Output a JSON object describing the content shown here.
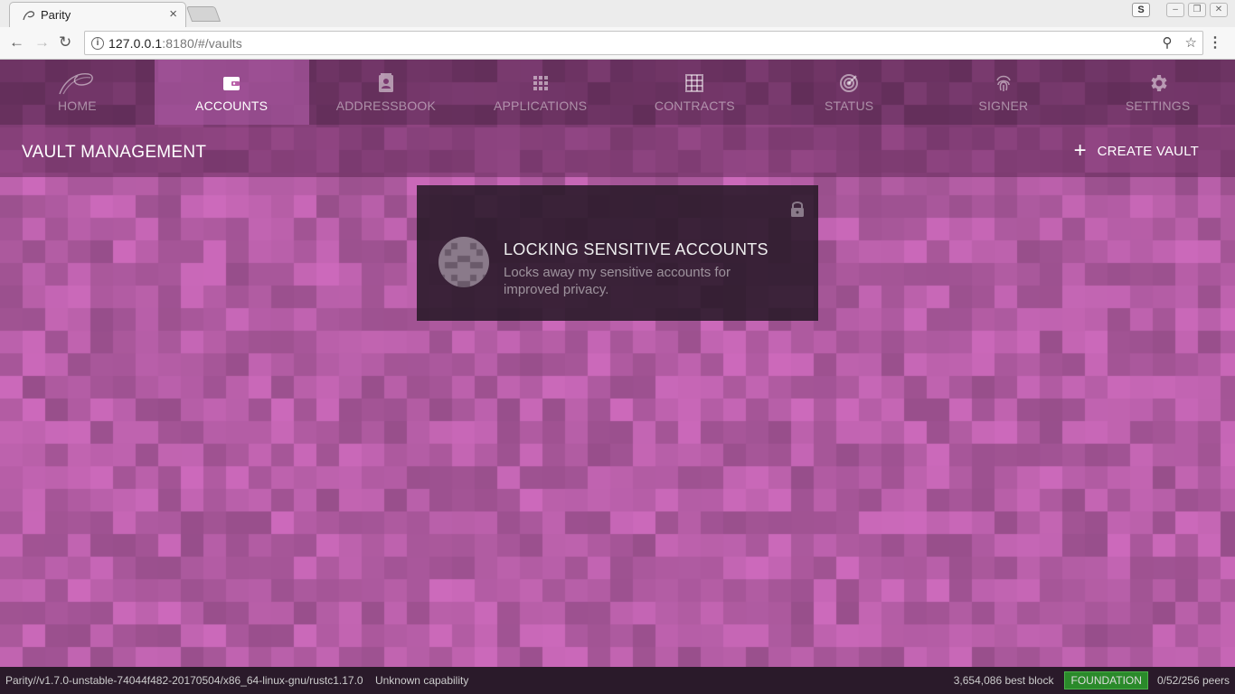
{
  "browser": {
    "tab_title": "Parity",
    "tab_close": "×",
    "profile_letter": "S",
    "url_host": "127.0.0.1",
    "url_rest": ":8180/#/vaults"
  },
  "nav": {
    "items": [
      {
        "label": "HOME",
        "icon": "parity-logo-icon"
      },
      {
        "label": "ACCOUNTS",
        "icon": "wallet-icon",
        "active": true
      },
      {
        "label": "ADDRESSBOOK",
        "icon": "contact-icon"
      },
      {
        "label": "APPLICATIONS",
        "icon": "apps-grid-icon"
      },
      {
        "label": "CONTRACTS",
        "icon": "table-grid-icon"
      },
      {
        "label": "STATUS",
        "icon": "radar-icon"
      },
      {
        "label": "SIGNER",
        "icon": "fingerprint-icon"
      },
      {
        "label": "SETTINGS",
        "icon": "gear-icon"
      }
    ]
  },
  "subheader": {
    "title": "VAULT MANAGEMENT",
    "create_label": "CREATE VAULT"
  },
  "vault_card": {
    "title": "LOCKING SENSITIVE ACCOUNTS",
    "description": "Locks away my sensitive accounts for improved privacy.",
    "locked": true
  },
  "status_bar": {
    "version": "Parity//v1.7.0-unstable-74044f482-20170504/x86_64-linux-gnu/rustc1.17.0",
    "capability": "Unknown capability",
    "best_block": "3,654,086 best block",
    "chain": "FOUNDATION",
    "peers": "0/52/256 peers"
  },
  "colors": {
    "background": "#b25ca3",
    "chain_badge": "#2a8a2a"
  }
}
